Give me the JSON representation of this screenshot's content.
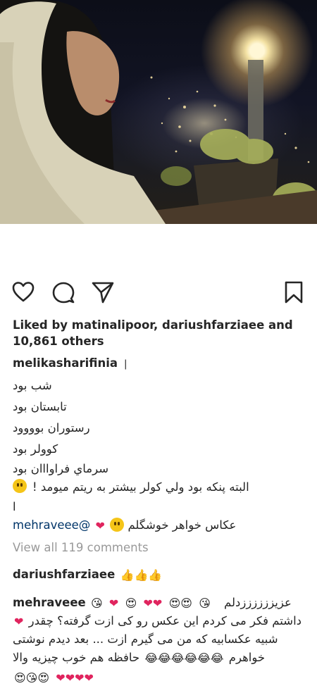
{
  "post": {
    "likes_line1": "Liked by matinalipoor, dariushfarziaee and",
    "likes_line2": "10,861 others",
    "caption_username": "melikasharifinia",
    "caption_lines": [
      "شب بود",
      "تابستان بود",
      "رستوران بوووود",
      "کوولر بود",
      "سرماي فراوااان بود",
      "البته پنکه بود ولي کولر بيشتر به ريتم ميومد !",
      "ا"
    ],
    "view_all_comments": "View all 119 comments"
  },
  "comments": [
    {
      "username": "mehraveee@",
      "text": "عكاس خواهر خوشگلم"
    },
    {
      "username": "dariushfarziaee",
      "text": "👍👍👍"
    },
    {
      "username": "mehraveee",
      "lines": [
        "عزیززززززدلم",
        "داشتم فکر می کردم این عکس رو کی ازت گرفته؟ چقدر",
        "شبیه عکسابیه که من می گیرم ازت ... بعد دیدم نوشتی",
        "خواهرم",
        "حافظه هم خوب چیزیه والا"
      ]
    }
  ],
  "icons": [
    "heart-icon",
    "comment-icon",
    "share-icon",
    "bookmark-icon"
  ],
  "colors": {
    "text": "#262626",
    "muted": "#999999",
    "link": "#003569",
    "heart": "#e0245e"
  }
}
